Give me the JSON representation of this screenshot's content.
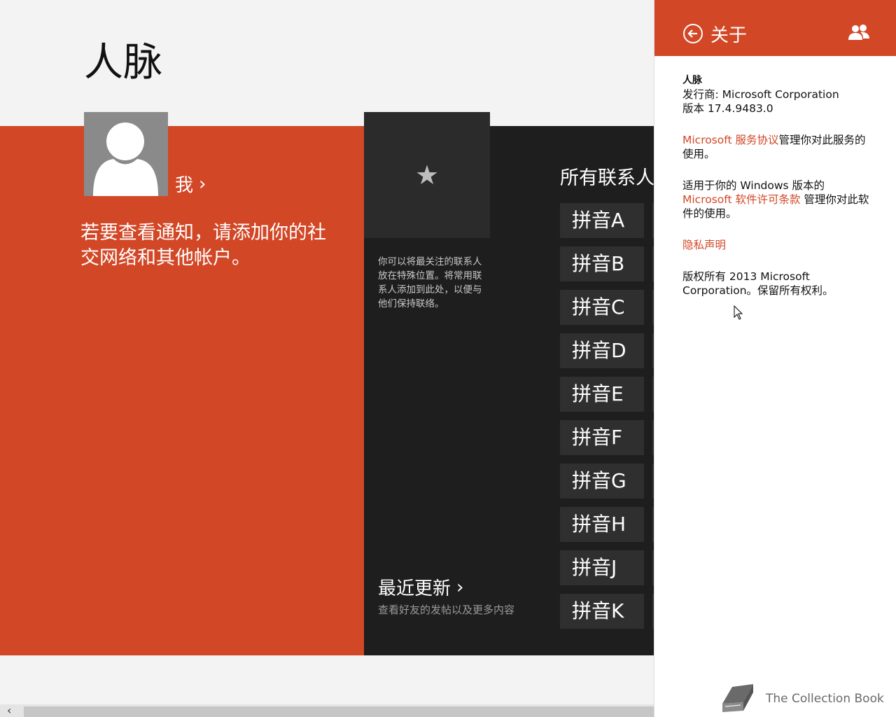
{
  "app": {
    "title": "人脉"
  },
  "me": {
    "label": "我"
  },
  "notification_text": "若要查看通知，请添加你的社交网络和其他帐户。",
  "favorites": {
    "star": "★",
    "description": "你可以将最关注的联系人放在特殊位置。将常用联系人添加到此处，以便与他们保持联络。"
  },
  "recent": {
    "title": "最近更新",
    "subtitle": "查看好友的发帖以及更多内容"
  },
  "all_contacts": {
    "title": "所有联系人"
  },
  "pinyin_groups": [
    "拼音A",
    "拼音B",
    "拼音C",
    "拼音D",
    "拼音E",
    "拼音F",
    "拼音G",
    "拼音H",
    "拼音J",
    "拼音K"
  ],
  "about": {
    "title": "关于",
    "app_name": "人脉",
    "publisher": "发行商: Microsoft Corporation",
    "version": "版本 17.4.9483.0",
    "service_link": "Microsoft 服务协议",
    "service_text": "管理你对此服务的使用。",
    "license_prefix": "适用于你的 Windows 版本的",
    "license_link": "Microsoft 软件许可条款",
    "license_text": " 管理你对此软件的使用。",
    "privacy_link": "隐私声明",
    "copyright": "版权所有 2013 Microsoft Corporation。保留所有权利。"
  },
  "watermark": "The Collection Book",
  "colors": {
    "accent": "#d24726",
    "dark_band": "#1e1e1e",
    "tile": "#2f2f2f"
  },
  "icons": {
    "back": "back-arrow-icon",
    "people": "people-icon",
    "favorite": "star-icon",
    "avatar": "person-placeholder-icon",
    "book": "book-icon"
  }
}
